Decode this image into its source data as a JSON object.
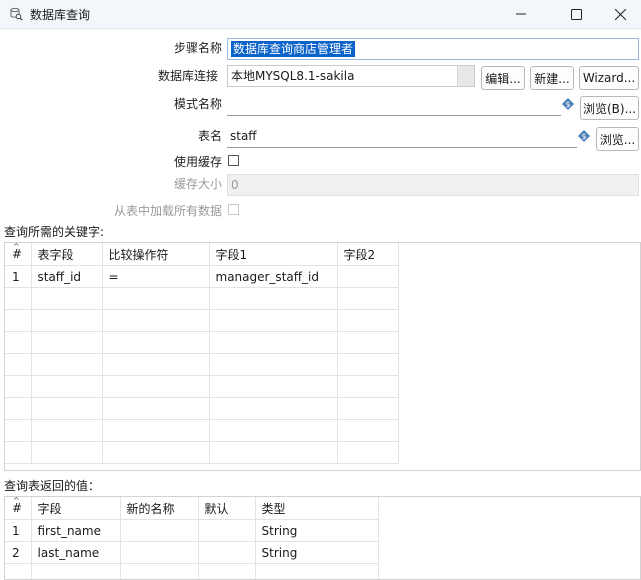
{
  "window": {
    "title": "数据库查询"
  },
  "form": {
    "step_name_label": "步骤名称",
    "step_name_value": "数据库查询商店管理者",
    "connection_label": "数据库连接",
    "connection_value": "本地MYSQL8.1-sakila",
    "edit_button": "编辑...",
    "new_button": "新建...",
    "wizard_button": "Wizard...",
    "schema_label": "模式名称",
    "schema_value": "",
    "browse_b_button": "浏览(B)...",
    "table_label": "表名",
    "table_value": "staff",
    "browse_button": "浏览...",
    "use_cache_label": "使用缓存",
    "use_cache_checked": false,
    "cache_size_label": "缓存大小",
    "cache_size_value": "0",
    "load_all_label": "从表中加载所有数据",
    "load_all_checked": false
  },
  "keys_section": {
    "title": "查询所需的关键字:",
    "columns": [
      "#",
      "表字段",
      "比较操作符",
      "字段1",
      "字段2"
    ],
    "rows": [
      [
        "1",
        "staff_id",
        "=",
        "manager_staff_id",
        ""
      ]
    ]
  },
  "return_section": {
    "title": "查询表返回的值：",
    "columns": [
      "#",
      "字段",
      "新的名称",
      "默认",
      "类型"
    ],
    "rows": [
      [
        "1",
        "first_name",
        "",
        "",
        "String"
      ],
      [
        "2",
        "last_name",
        "",
        "",
        "String"
      ]
    ]
  },
  "icons": {
    "app": "database-lookup-icon",
    "minimize": "minimize-icon",
    "maximize": "maximize-icon",
    "close": "close-icon",
    "variable": "variable-diamond-icon"
  },
  "colors": {
    "selection": "#0b62c9",
    "titlebar": "#f3f6fb",
    "variable_icon": "#4a7fb8"
  }
}
